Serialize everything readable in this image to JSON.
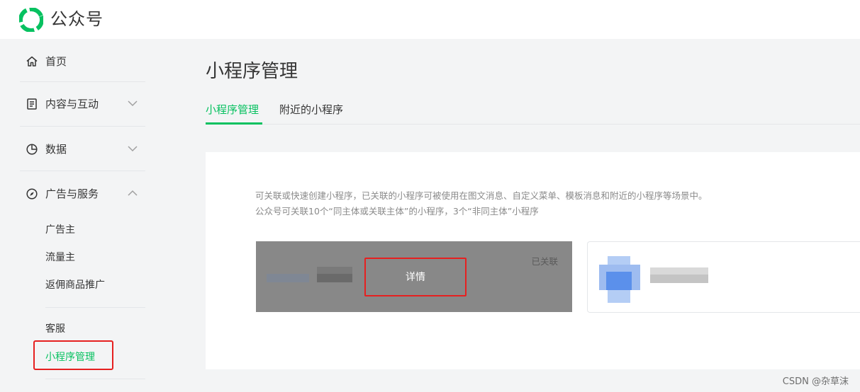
{
  "header": {
    "logo_text": "公众号"
  },
  "sidebar": {
    "items": [
      {
        "label": "首页",
        "icon": "home-icon"
      },
      {
        "label": "内容与互动",
        "icon": "document-icon",
        "expanded": false
      },
      {
        "label": "数据",
        "icon": "pie-chart-icon",
        "expanded": false
      },
      {
        "label": "广告与服务",
        "icon": "compass-icon",
        "expanded": true
      }
    ],
    "sub_items": [
      "广告主",
      "流量主",
      "返佣商品推广",
      "客服",
      "小程序管理"
    ]
  },
  "main": {
    "title": "小程序管理",
    "tabs": [
      {
        "label": "小程序管理",
        "active": true
      },
      {
        "label": "附近的小程序",
        "active": false
      }
    ],
    "desc_line1": "可关联或快速创建小程序，已关联的小程序可被使用在图文消息、自定义菜单、模板消息和附近的小程序等场景中。",
    "desc_line2": "公众号可关联10个“同主体或关联主体”的小程序，3个“非同主体”小程序",
    "linked_card": {
      "status": "已关联",
      "detail_button": "详情"
    }
  },
  "watermark": "CSDN @杂草沫",
  "colors": {
    "accent": "#07c160",
    "highlight_box": "#e62020",
    "card_overlay": "#888888"
  }
}
